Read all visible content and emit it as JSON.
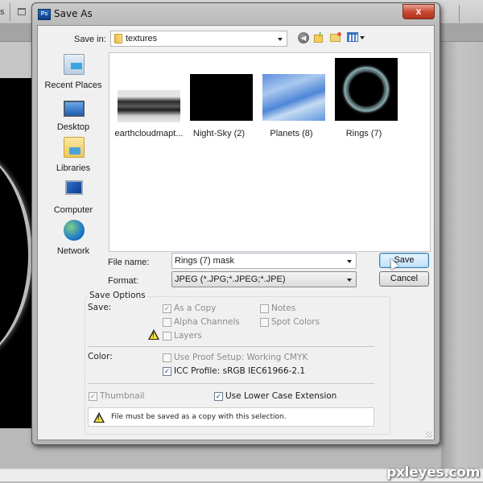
{
  "background_app": {
    "toolbar_fragment": "s",
    "watermark": "pxleyes.com"
  },
  "dialog": {
    "title": "Save As",
    "logo_text": "Ps",
    "close_label": "x",
    "save_in": {
      "label": "Save in:",
      "value": "textures"
    },
    "places": [
      {
        "label": "Recent Places",
        "icon": "recent-places-icon"
      },
      {
        "label": "Desktop",
        "icon": "desktop-icon"
      },
      {
        "label": "Libraries",
        "icon": "libraries-icon"
      },
      {
        "label": "Computer",
        "icon": "computer-icon"
      },
      {
        "label": "Network",
        "icon": "network-icon"
      }
    ],
    "files": [
      {
        "name": "earthcloudmapt..."
      },
      {
        "name": "Night-Sky (2)"
      },
      {
        "name": "Planets (8)"
      },
      {
        "name": "Rings (7)"
      }
    ],
    "file_name": {
      "label": "File name:",
      "value": "Rings (7) mask"
    },
    "format": {
      "label": "Format:",
      "value": "JPEG (*.JPG;*.JPEG;*.JPE)"
    },
    "buttons": {
      "save": "Save",
      "cancel": "Cancel"
    },
    "save_options": {
      "title": "Save Options",
      "save_label": "Save:",
      "checkboxes": {
        "as_a_copy": {
          "label": "As a Copy",
          "checked": true,
          "enabled": false
        },
        "notes": {
          "label": "Notes",
          "checked": false,
          "enabled": false
        },
        "alpha_channels": {
          "label": "Alpha Channels",
          "checked": false,
          "enabled": false
        },
        "spot_colors": {
          "label": "Spot Colors",
          "checked": false,
          "enabled": false
        },
        "layers": {
          "label": "Layers",
          "checked": false,
          "enabled": false
        }
      },
      "color_label": "Color:",
      "use_proof_setup": {
        "label": "Use Proof Setup:  Working CMYK",
        "checked": false,
        "enabled": false
      },
      "icc_profile": {
        "label": "ICC Profile:  sRGB IEC61966-2.1",
        "checked": true,
        "enabled": true
      },
      "thumbnail": {
        "label": "Thumbnail",
        "checked": true,
        "enabled": false
      },
      "lower_case_ext": {
        "label": "Use Lower Case Extension",
        "checked": true,
        "enabled": true
      },
      "warning_message": "File must be saved as a copy with this selection."
    }
  }
}
